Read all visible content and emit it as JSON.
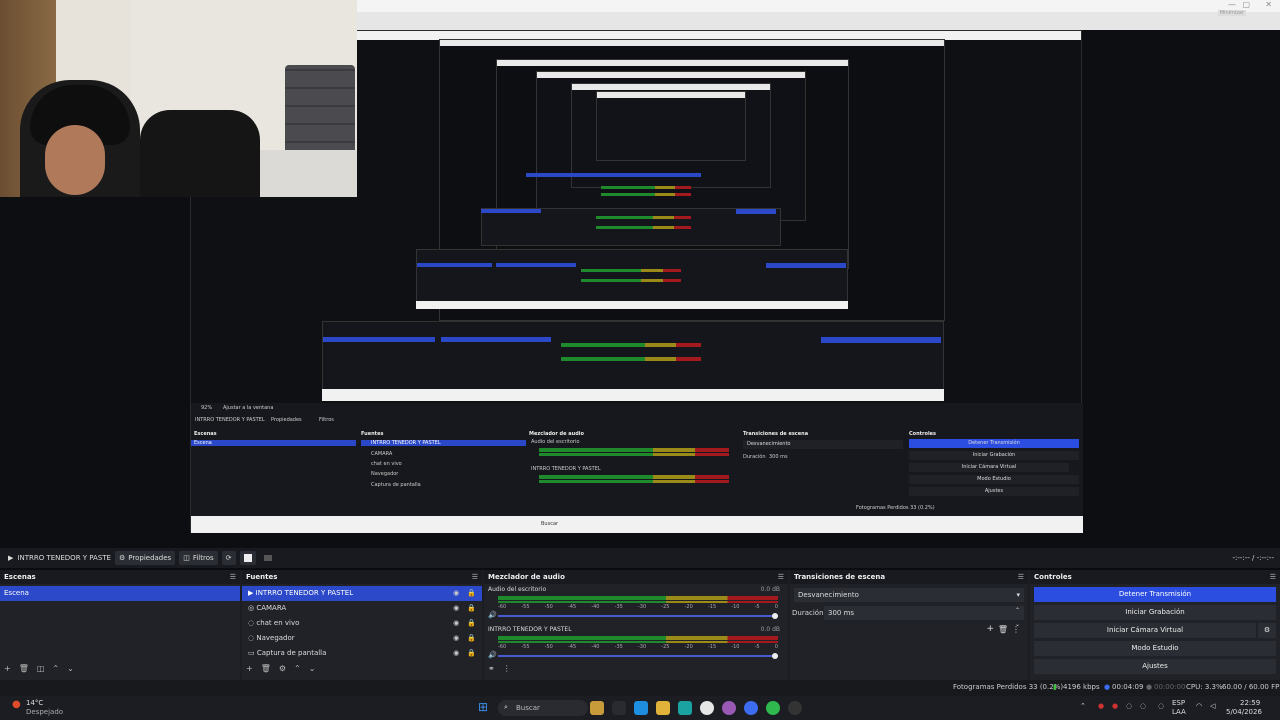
{
  "window": {
    "controls_hint": "Minimizar"
  },
  "inner_preview": {
    "toolbar": {
      "source": "INTRRO TENEDOR Y PASTEL",
      "props": "Propiedades",
      "filters": "Filtros"
    },
    "zoom": "92%",
    "fit": "Ajustar a la ventana",
    "panels": {
      "scenes": "Escenas",
      "sources": "Fuentes",
      "mixer": "Mezclador de audio",
      "transitions": "Transiciones de escena",
      "controls": "Controles"
    },
    "scene": "Escena",
    "sources": [
      "INTRRO TENEDOR Y PASTEL",
      "CAMARA",
      "chat en vivo",
      "Navegador",
      "Captura de pantalla"
    ],
    "mixer": [
      "Audio del escritorio",
      "INTRRO TENEDOR Y PASTEL"
    ],
    "transition": "Desvanecimiento",
    "duration_label": "Duración",
    "duration": "300 ms",
    "controls": [
      "Detener Transmisión",
      "Iniciar Grabación",
      "Iniciar Cámara Virtual",
      "Modo Estudio",
      "Ajustes"
    ],
    "status": "Fotogramas Perdidos 33 (0.2%)",
    "taskbar_search": "Buscar"
  },
  "toolbar": {
    "source_name": "INTRRO TENEDOR Y PASTE",
    "properties": "Propiedades",
    "filters": "Filtros",
    "right_text": "-:--:-- / -:--:--"
  },
  "scenes": {
    "title": "Escenas",
    "items": [
      "Escena"
    ]
  },
  "sources": {
    "title": "Fuentes",
    "items": [
      "INTRRO TENEDOR Y PASTEL",
      "CAMARA",
      "chat en vivo",
      "Navegador",
      "Captura de pantalla"
    ]
  },
  "mixer": {
    "title": "Mezclador de audio",
    "channels": [
      {
        "name": "Audio del escritorio",
        "db": "0.0 dB"
      },
      {
        "name": "INTRRO TENEDOR Y PASTEL",
        "db": "0.0 dB"
      }
    ],
    "scale": [
      "-60",
      "-55",
      "-50",
      "-45",
      "-40",
      "-35",
      "-30",
      "-25",
      "-20",
      "-15",
      "-10",
      "-5",
      "0"
    ]
  },
  "transitions": {
    "title": "Transiciones de escena",
    "selected": "Desvanecimiento",
    "duration_label": "Duración",
    "duration": "300 ms"
  },
  "controls": {
    "title": "Controles",
    "buttons": [
      "Detener Transmisión",
      "Iniciar Grabación",
      "Iniciar Cámara Virtual",
      "Modo Estudio",
      "Ajustes"
    ]
  },
  "status": {
    "dropped": "Fotogramas Perdidos 33 (0.2%)",
    "bitrate": "4196 kbps",
    "stream_time": "00:04:09",
    "rec_time": "00:00:00",
    "cpu": "CPU: 3.3%",
    "fps": "60.00 / 60.00 FPS"
  },
  "taskbar": {
    "weather_temp": "14°C",
    "weather_desc": "Despejado",
    "search": "Buscar",
    "lang1": "ESP",
    "lang2": "LAA",
    "time": "22:59",
    "date": "5/04/2026"
  },
  "colors": {
    "accent": "#2c4ee0",
    "selected": "#2b49c9",
    "bg": "#1b1d22"
  }
}
